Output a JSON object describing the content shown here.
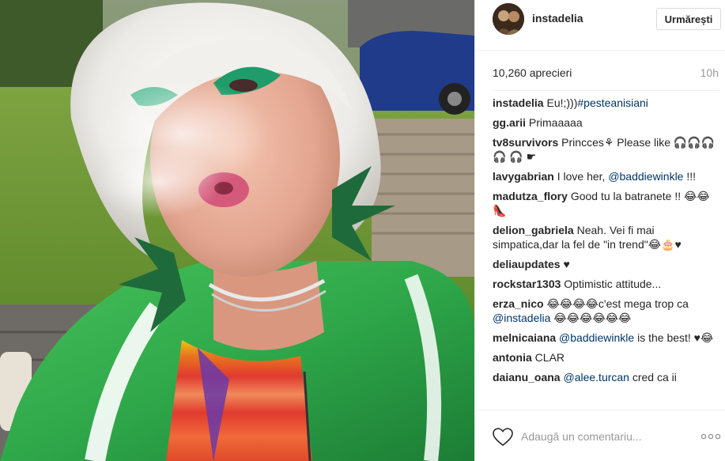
{
  "post": {
    "author": "instadelia",
    "follow_label": "Urmărești",
    "likes": "10,260 aprecieri",
    "time": "10h"
  },
  "comments": [
    {
      "author": "instadelia",
      "parts": [
        {
          "t": "Eu!;)))",
          "m": false
        },
        {
          "t": "#pesteanisiani",
          "m": true
        }
      ]
    },
    {
      "author": "gg.arii",
      "parts": [
        {
          "t": "Primaaaaa",
          "m": false
        }
      ]
    },
    {
      "author": "tv8survivors",
      "parts": [
        {
          "t": "Princces⚘ Please like 🎧🎧🎧🎧 🎧 ☛",
          "m": false
        }
      ]
    },
    {
      "author": "lavygabrian",
      "parts": [
        {
          "t": "I love her, ",
          "m": false
        },
        {
          "t": "@baddiewinkle",
          "m": true
        },
        {
          "t": " !!!",
          "m": false
        }
      ]
    },
    {
      "author": "madutza_flory",
      "parts": [
        {
          "t": "Good tu la batranete !! 😂😂👠",
          "m": false
        }
      ]
    },
    {
      "author": "delion_gabriela",
      "parts": [
        {
          "t": "Neah. Vei fi mai simpatica,dar la fel de \"in trend\"😂🎂♥",
          "m": false
        }
      ]
    },
    {
      "author": "deliaupdates",
      "parts": [
        {
          "t": "♥",
          "m": false
        }
      ]
    },
    {
      "author": "rockstar1303",
      "parts": [
        {
          "t": "Optimistic attitude...",
          "m": false
        }
      ]
    },
    {
      "author": "erza_nico",
      "parts": [
        {
          "t": "😂😂😂😂c'est mega trop ca ",
          "m": false
        },
        {
          "t": "@instadelia",
          "m": true
        },
        {
          "t": " 😂😂😂😂😂😂",
          "m": false
        }
      ]
    },
    {
      "author": "melnicaiana",
      "parts": [
        {
          "t": "@baddiewinkle",
          "m": true
        },
        {
          "t": " is the best! ♥😂",
          "m": false
        }
      ]
    },
    {
      "author": "antonia",
      "parts": [
        {
          "t": "CLAR",
          "m": false
        }
      ]
    },
    {
      "author": "daianu_oana",
      "parts": [
        {
          "t": "@alee.turcan",
          "m": true
        },
        {
          "t": " cred ca ii",
          "m": false
        }
      ]
    }
  ],
  "footer": {
    "comment_placeholder": "Adaugă un comentariu...",
    "like_icon": "heart-outline-icon",
    "more_icon": "more-options-icon"
  },
  "colors": {
    "mention": "#003569",
    "muted": "#999999",
    "text": "#262626",
    "jacket_green": "#2fa84a",
    "eyeshadow": "#1f9c6a"
  }
}
